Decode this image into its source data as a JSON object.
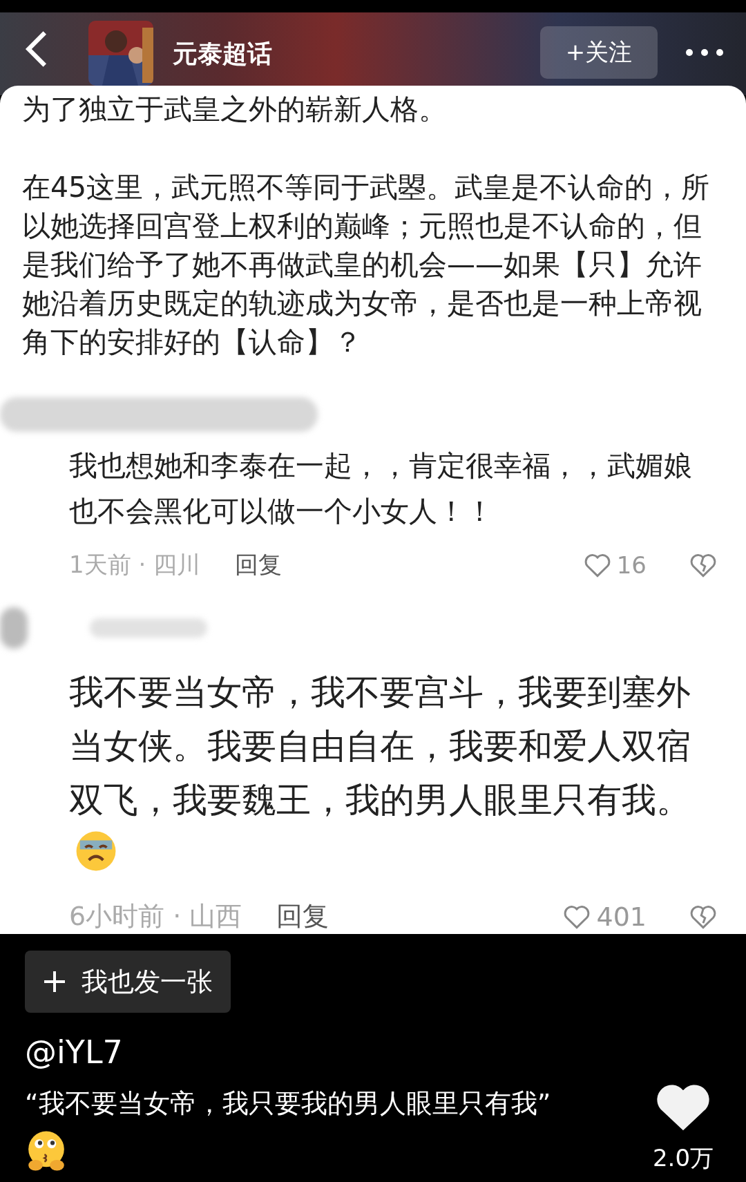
{
  "header": {
    "title": "元泰超话",
    "follow_button": "+关注"
  },
  "post": {
    "paragraphs": [
      "为了独立于武皇之外的崭新人格。",
      "在45这里，武元照不等同于武曌。武皇是不认命的，所以她选择回宫登上权利的巅峰；元照也是不认命的，但是我们给予了她不再做武皇的机会——如果【只】允许她沿着历史既定的轨迹成为女帝，是否也是一种上帝视角下的安排好的【认命】？"
    ]
  },
  "comments": [
    {
      "kind": "small",
      "text": "我也想她和李泰在一起，，肯定很幸福，，武媚娘也不会黑化可以做一个小女人！！",
      "time_location": "1天前 · 四川",
      "reply": "回复",
      "likes": "16"
    },
    {
      "kind": "large",
      "text": "我不要当女帝，我不要宫斗，我要到塞外当女侠。我要自由自在，我要和爱人双宿双飞，我要魏王，我的男人眼里只有我。",
      "time_location": "6小时前 · 山西",
      "reply": "回复",
      "likes": "401"
    }
  ],
  "footer": {
    "post_button": "我也发一张",
    "author": "@iYL7",
    "caption": "“我不要当女帝，我只要我的男人眼里只有我”",
    "likes": "2.0万"
  }
}
